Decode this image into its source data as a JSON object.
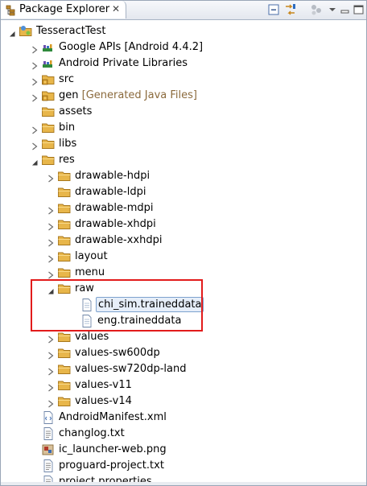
{
  "view": {
    "title": "Package Explorer",
    "close_glyph": "✕",
    "toolbar": [
      "collapse-all-icon",
      "link-with-editor-icon",
      "view-menu-icon"
    ]
  },
  "tree": [
    {
      "label": "TesseractTest",
      "depth": 0,
      "twisty": "expanded",
      "icon": "android-project-icon"
    },
    {
      "label": "Google APIs [Android 4.4.2]",
      "depth": 1,
      "twisty": "collapsed",
      "icon": "library-icon"
    },
    {
      "label": "Android Private Libraries",
      "depth": 1,
      "twisty": "collapsed",
      "icon": "library-icon"
    },
    {
      "label": "src",
      "depth": 1,
      "twisty": "collapsed",
      "icon": "source-folder-icon"
    },
    {
      "label": "gen",
      "decoration": "[Generated Java Files]",
      "depth": 1,
      "twisty": "collapsed",
      "icon": "source-folder-icon"
    },
    {
      "label": "assets",
      "depth": 1,
      "twisty": "none",
      "icon": "folder-icon"
    },
    {
      "label": "bin",
      "depth": 1,
      "twisty": "collapsed",
      "icon": "folder-icon"
    },
    {
      "label": "libs",
      "depth": 1,
      "twisty": "collapsed",
      "icon": "folder-icon"
    },
    {
      "label": "res",
      "depth": 1,
      "twisty": "expanded",
      "icon": "folder-icon"
    },
    {
      "label": "drawable-hdpi",
      "depth": 2,
      "twisty": "collapsed",
      "icon": "folder-icon"
    },
    {
      "label": "drawable-ldpi",
      "depth": 2,
      "twisty": "none",
      "icon": "folder-icon"
    },
    {
      "label": "drawable-mdpi",
      "depth": 2,
      "twisty": "collapsed",
      "icon": "folder-icon"
    },
    {
      "label": "drawable-xhdpi",
      "depth": 2,
      "twisty": "collapsed",
      "icon": "folder-icon"
    },
    {
      "label": "drawable-xxhdpi",
      "depth": 2,
      "twisty": "collapsed",
      "icon": "folder-icon"
    },
    {
      "label": "layout",
      "depth": 2,
      "twisty": "collapsed",
      "icon": "folder-icon"
    },
    {
      "label": "menu",
      "depth": 2,
      "twisty": "collapsed",
      "icon": "folder-icon"
    },
    {
      "label": "raw",
      "depth": 2,
      "twisty": "expanded",
      "icon": "folder-icon"
    },
    {
      "label": "chi_sim.traineddata",
      "depth": 3,
      "twisty": "none",
      "icon": "file-icon",
      "selected": true
    },
    {
      "label": "eng.traineddata",
      "depth": 3,
      "twisty": "none",
      "icon": "file-icon"
    },
    {
      "label": "values",
      "depth": 2,
      "twisty": "collapsed",
      "icon": "folder-icon"
    },
    {
      "label": "values-sw600dp",
      "depth": 2,
      "twisty": "collapsed",
      "icon": "folder-icon"
    },
    {
      "label": "values-sw720dp-land",
      "depth": 2,
      "twisty": "collapsed",
      "icon": "folder-icon"
    },
    {
      "label": "values-v11",
      "depth": 2,
      "twisty": "collapsed",
      "icon": "folder-icon"
    },
    {
      "label": "values-v14",
      "depth": 2,
      "twisty": "collapsed",
      "icon": "folder-icon"
    },
    {
      "label": "AndroidManifest.xml",
      "depth": 1,
      "twisty": "none",
      "icon": "xml-file-icon"
    },
    {
      "label": "changlog.txt",
      "depth": 1,
      "twisty": "none",
      "icon": "text-file-icon"
    },
    {
      "label": "ic_launcher-web.png",
      "depth": 1,
      "twisty": "none",
      "icon": "image-file-icon"
    },
    {
      "label": "proguard-project.txt",
      "depth": 1,
      "twisty": "none",
      "icon": "text-file-icon"
    },
    {
      "label": "project.properties",
      "depth": 1,
      "twisty": "none",
      "icon": "properties-file-icon"
    }
  ],
  "colors": {
    "highlight_box": "#e21b1b",
    "folder": "#e8b64a",
    "decoration": "#8b6a3c",
    "selection": "#e6eef9"
  }
}
